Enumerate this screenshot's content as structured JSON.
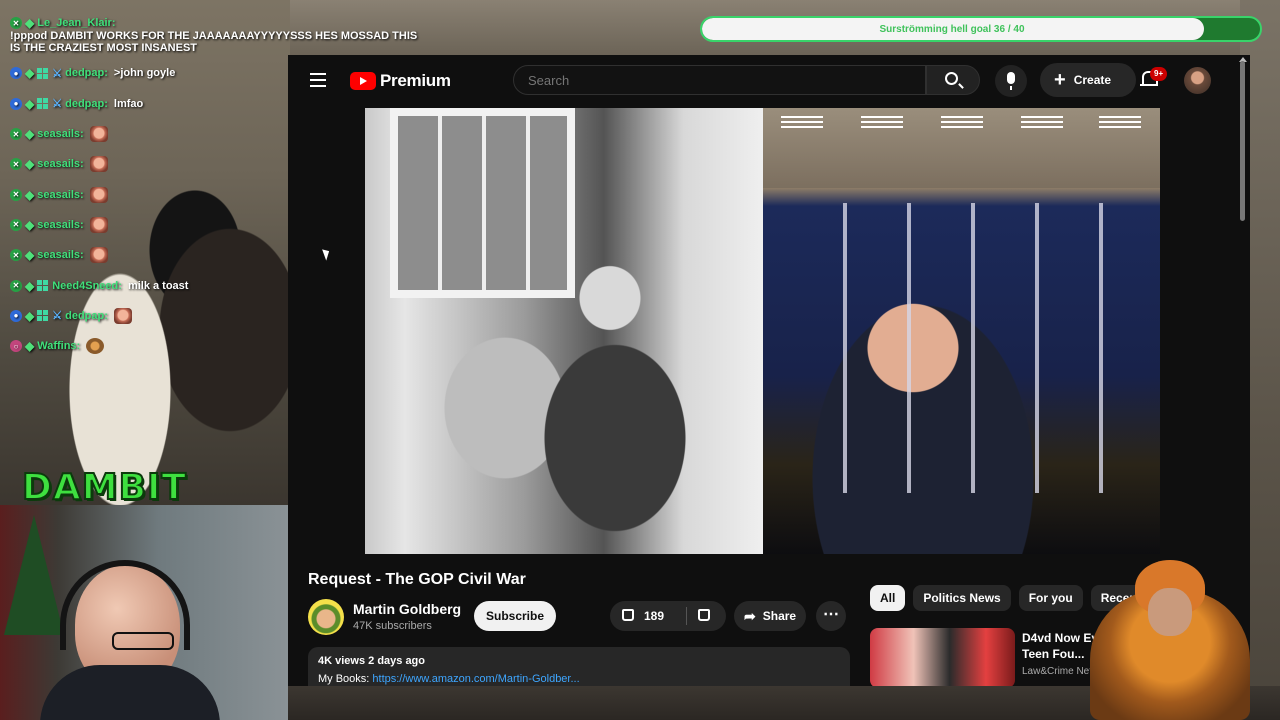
{
  "chat": {
    "messages": [
      {
        "user": "Le_Jean_Klair:",
        "text": "",
        "user_color": "#3fe07a"
      },
      {
        "user": "",
        "text": "!pppod DAMBIT WORKS FOR THE JAAAAAAAYYYYYSSS HES MOSSAD THIS IS THE CRAZIEST MOST INSANEST"
      },
      {
        "user": "dedpap:",
        "text": ">john goyle",
        "user_color": "#3fe07a"
      },
      {
        "user": "dedpap:",
        "text": "lmfao",
        "user_color": "#3fe07a"
      },
      {
        "user": "seasails:",
        "text": "",
        "user_color": "#3fe07a"
      },
      {
        "user": "seasails:",
        "text": "",
        "user_color": "#3fe07a"
      },
      {
        "user": "seasails:",
        "text": "",
        "user_color": "#3fe07a"
      },
      {
        "user": "seasails:",
        "text": "",
        "user_color": "#3fe07a"
      },
      {
        "user": "seasails:",
        "text": "",
        "user_color": "#3fe07a"
      },
      {
        "user": "Need4Sneed:",
        "text": "milk a toast",
        "user_color": "#3fe07a"
      },
      {
        "user": "dedpap:",
        "text": "",
        "user_color": "#3fe07a"
      },
      {
        "user": "Waffins:",
        "text": "",
        "user_color": "#3fe07a"
      }
    ]
  },
  "overlay": {
    "logo": "DAMBIT",
    "goal_text": "Surströmming hell goal 36 / 40",
    "goal_progress": 0.9,
    "accent": "#3fd95f"
  },
  "youtube": {
    "brand": "Premium",
    "search_placeholder": "Search",
    "create_label": "Create",
    "notification_count": "9+",
    "video": {
      "title": "Request - The GOP Civil War",
      "channel": "Martin Goldberg",
      "subscribers": "47K subscribers",
      "subscribe_label": "Subscribe",
      "likes": "189",
      "share_label": "Share",
      "stats": "4K views  2 days ago",
      "desc_prefix": "My Books: ",
      "desc_link": "https://www.amazon.com/Martin-Goldber..."
    },
    "chips": [
      "All",
      "Politics News",
      "For you",
      "Recently"
    ],
    "recommendation": {
      "title": "D4vd Now Eyed as Sus... After Dead Teen Fou...",
      "channel": "Law&Crime Netw..."
    },
    "colors": {
      "brand_red": "#ff0000",
      "link": "#3ea6ff",
      "bg": "#0f0f0f"
    }
  }
}
